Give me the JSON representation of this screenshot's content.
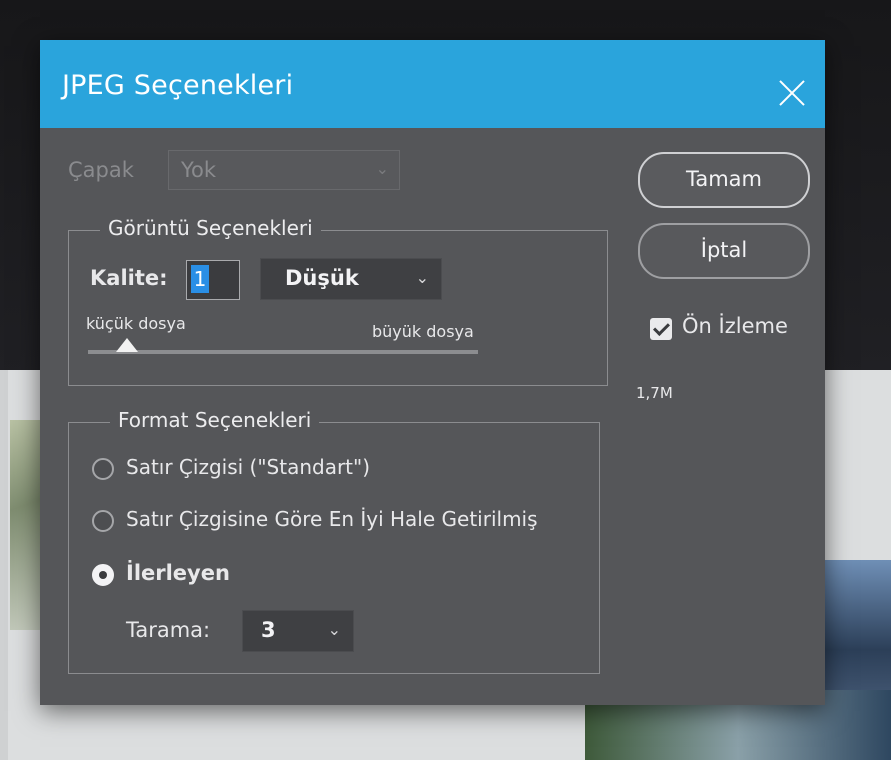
{
  "dialog": {
    "title": "JPEG Seçenekleri",
    "close_icon": "close-icon",
    "accent_color": "#2aa4dc"
  },
  "matte": {
    "label": "Çapak",
    "value": "Yok"
  },
  "image_options": {
    "legend": "Görüntü Seçenekleri",
    "quality_label": "Kalite:",
    "quality_value": "1",
    "quality_preset": "Düşük",
    "slider_min_label": "küçük dosya",
    "slider_max_label": "büyük dosya",
    "slider_level": 0.1
  },
  "format_options": {
    "legend": "Format Seçenekleri",
    "options": [
      {
        "label": "Satır Çizgisi (\"Standart\")",
        "selected": false
      },
      {
        "label": "Satır Çizgisine Göre En İyi Hale Getirilmiş",
        "selected": false
      },
      {
        "label": "İlerleyen",
        "selected": true
      }
    ],
    "scans_label": "Tarama:",
    "scans_value": "3"
  },
  "buttons": {
    "ok": "Tamam",
    "cancel": "İptal"
  },
  "preview": {
    "label": "Ön İzleme",
    "checked": true,
    "file_size": "1,7M"
  }
}
